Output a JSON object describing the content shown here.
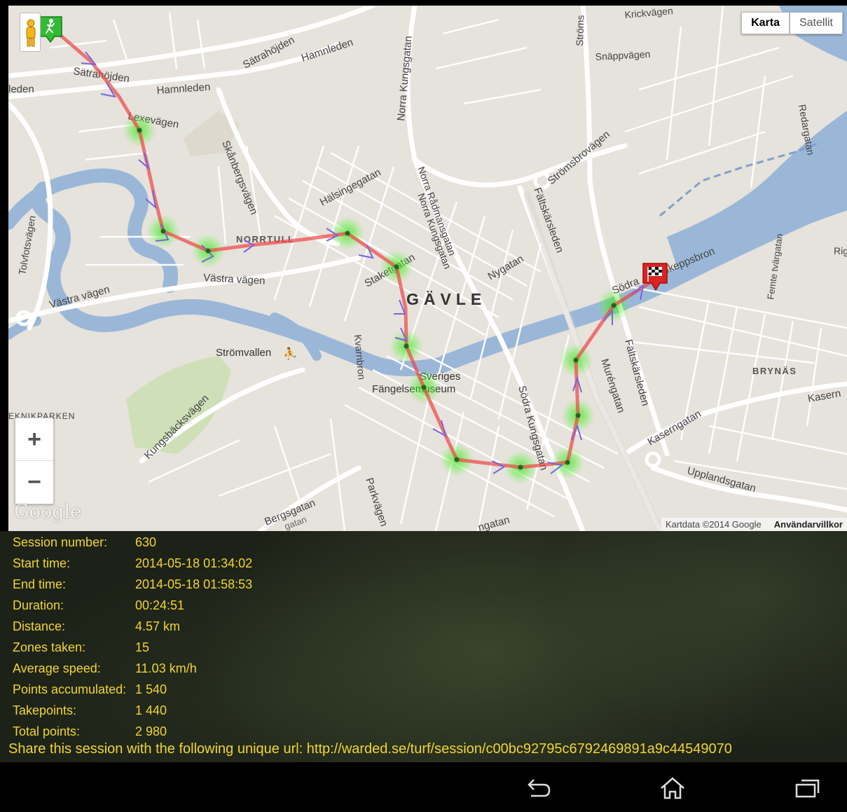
{
  "map": {
    "type_buttons": [
      {
        "label": "Karta",
        "active": true
      },
      {
        "label": "Satellit",
        "active": false
      }
    ],
    "zoom_in": "+",
    "zoom_out": "−",
    "logo": "Google",
    "attribution": "Kartdata ©2014 Google",
    "terms": "Användarvillkor",
    "labels": {
      "city": "GÄVLE",
      "norrtull": "NORRTULL",
      "brynas": "BRYNÄS",
      "satrahojden_top": "Sätrahöjden",
      "satrahojden": "Sätrahöjden",
      "hamnleden_top": "Hamnleden",
      "hamnleden": "Hamnleden",
      "leden": "leden",
      "lexevagen": "Lexevägen",
      "skanbergsvagen": "Skånbergsvägen",
      "halsingegatan": "Hälsingegatan",
      "norra_kungsgatan": "Norra Kungsgatan",
      "norra_radmansgatan": "Norra Rådmansgatan",
      "norra_kungsgatan2": "Norra Kungsgatan",
      "staketgatan": "Staketgatan",
      "nygatan": "Nygatan",
      "faltskarsleden": "Fältskärsleden",
      "faltskarsleden2": "Fältskärsleden",
      "stromsbrovagen": "Strömsbrovägen",
      "stroms": "Ströms",
      "krickvagen": "Krickvägen",
      "snappvagen": "Snäppvägen",
      "redargatan": "Redargatan",
      "femte_tvargatan": "Femte tvärgatan",
      "rig": "Rig",
      "sodra": "Södra",
      "skeppsbron": "Skeppsbron",
      "tolvfotsvagen": "Tolvfotsvägen",
      "vastra_vagen_left": "Västra vägen",
      "vastra_vagen": "Västra vägen",
      "stromvallen": "Strömvallen",
      "kvarnbron": "Kvarnbron",
      "sveriges": "Sveriges",
      "fangelsemuseum": "Fängelsemuseum",
      "sodra_kungsgatan": "Södra Kungsgatan",
      "muregatan": "Muréngatan",
      "kaserngatan": "Kaserngatan",
      "kasern": "Kasern",
      "upplandsgatan": "Upplandsgatan",
      "kungsbacksvagen": "Kungsbäcksvägen",
      "parkvagen": "Parkvägen",
      "bergsgatan": "Bergsgatan",
      "bergsgatan2": "gatan",
      "ngatan": "ngatan",
      "teknikparken": "EKNIKPARKEN"
    }
  },
  "session": {
    "rows": [
      {
        "label": "Session number:",
        "value": "630"
      },
      {
        "label": "Start time:",
        "value": "2014-05-18 01:34:02"
      },
      {
        "label": "End time:",
        "value": "2014-05-18 01:58:53"
      },
      {
        "label": "Duration:",
        "value": "00:24:51"
      },
      {
        "label": "Distance:",
        "value": "4.57 km"
      },
      {
        "label": "Zones taken:",
        "value": "15"
      },
      {
        "label": "Average speed:",
        "value": "11.03 km/h"
      },
      {
        "label": "Points accumulated:",
        "value": "1 540"
      },
      {
        "label": "Takepoints:",
        "value": "1 440"
      },
      {
        "label": "Total points:",
        "value": "2 980"
      }
    ],
    "share_text": "Share this session with the following unique url: http://warded.se/turf/session/c00bc92795c6792469891a9c44549070"
  },
  "colors": {
    "panel_text": "#f0d52f",
    "route": "#ee4444",
    "zone": "#44dd22",
    "water": "#9ab7d8"
  },
  "icons": {
    "back": "back-icon",
    "home": "home-icon",
    "recents": "recent-apps-icon",
    "start": "walking-person-icon",
    "finish": "checkered-flag-icon",
    "pegman": "street-view-pegman-icon"
  }
}
